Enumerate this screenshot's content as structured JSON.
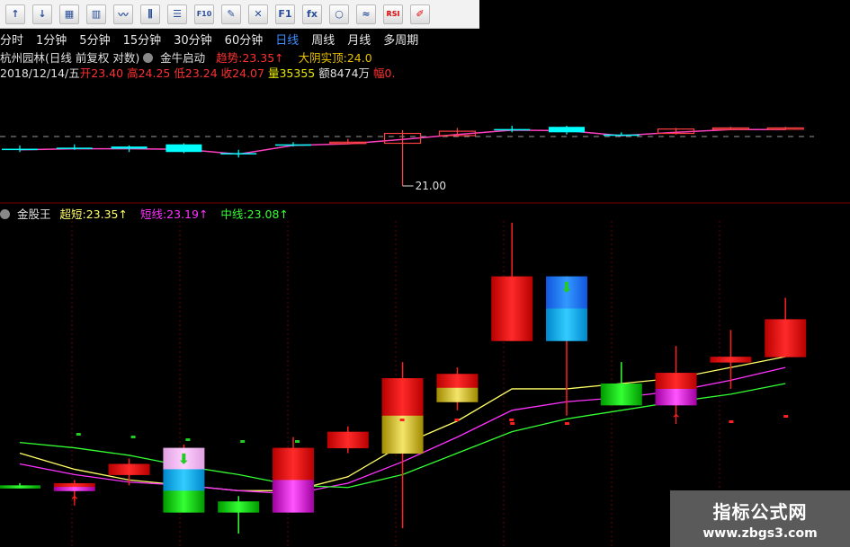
{
  "toolbar": {
    "buttons": [
      {
        "icon": "left-arrow-icon",
        "glyph": "↑"
      },
      {
        "icon": "down-arrow-icon",
        "glyph": "↓"
      },
      {
        "icon": "grid-icon",
        "glyph": "▦"
      },
      {
        "icon": "bars-icon",
        "glyph": "▥"
      },
      {
        "icon": "line-chart-icon",
        "glyph": "〰"
      },
      {
        "icon": "candlestick-icon",
        "glyph": "⫼"
      },
      {
        "icon": "list-icon",
        "glyph": "☰"
      },
      {
        "icon": "f10-icon",
        "glyph": "F10"
      },
      {
        "icon": "pencil-icon",
        "glyph": "✎"
      },
      {
        "icon": "compare-icon",
        "glyph": "✕"
      },
      {
        "icon": "f1-icon",
        "glyph": "F1"
      },
      {
        "icon": "formula-icon",
        "glyph": "fx"
      },
      {
        "icon": "circle-icon",
        "glyph": "○"
      },
      {
        "icon": "indicator-icon",
        "glyph": "≈"
      },
      {
        "icon": "rsi-icon",
        "glyph": "RSI"
      },
      {
        "icon": "brush-icon",
        "glyph": "✐"
      }
    ]
  },
  "periods": [
    "分时",
    "1分钟",
    "5分钟",
    "15分钟",
    "30分钟",
    "60分钟",
    "日线",
    "周线",
    "月线",
    "多周期"
  ],
  "active_period": "日线",
  "info": {
    "stock_title": "杭州园林(日线 前复权 对数)",
    "indicator_name": "金牛启动",
    "trend_label": "趋势:",
    "trend_value": "23.35↑",
    "big_yin_label": "大阴实顶:",
    "big_yin_value": "24.0",
    "date": "2018/12/14/五",
    "open_label": "开",
    "open_value": "23.40",
    "high_label": "高",
    "high_value": "24.25",
    "low_label": "低",
    "low_value": "23.24",
    "close_label": "收",
    "close_value": "24.07",
    "volume_label": "量",
    "volume_value": "35355",
    "amount_label": "额",
    "amount_value": "8474万",
    "amp_label": "幅",
    "amp_value": "0."
  },
  "sub_indicator": {
    "name": "金股王",
    "super_short_label": "超短:",
    "super_short_value": "23.35↑",
    "short_label": "短线:",
    "short_value": "23.19↑",
    "mid_label": "中线:",
    "mid_value": "23.08↑"
  },
  "colors": {
    "up": "#ff2020",
    "down": "#00ffff",
    "mid_line": "#ff3fbf",
    "yellow": "#ffff66",
    "green": "#33ff33",
    "magenta": "#ff33ff",
    "grid": "#6a0000"
  },
  "chart_data": [
    {
      "type": "candlestick",
      "panel": "main",
      "annotation": "21.00",
      "candles": [
        {
          "open": 22.7,
          "close": 22.7,
          "high": 22.85,
          "low": 22.55,
          "color": "down"
        },
        {
          "open": 22.75,
          "close": 22.75,
          "high": 22.9,
          "low": 22.65,
          "color": "down"
        },
        {
          "open": 22.8,
          "close": 22.7,
          "high": 22.85,
          "low": 22.55,
          "color": "down"
        },
        {
          "open": 22.9,
          "close": 22.55,
          "high": 22.95,
          "low": 22.5,
          "color": "down"
        },
        {
          "open": 22.5,
          "close": 22.5,
          "high": 22.65,
          "low": 22.3,
          "color": "down"
        },
        {
          "open": 22.9,
          "close": 22.9,
          "high": 23.0,
          "low": 22.8,
          "color": "down"
        },
        {
          "open": 22.95,
          "close": 23.0,
          "high": 23.15,
          "low": 22.95,
          "color": "up"
        },
        {
          "open": 22.95,
          "close": 23.4,
          "high": 23.55,
          "low": 21.0,
          "color": "up"
        },
        {
          "open": 23.3,
          "close": 23.5,
          "high": 23.65,
          "low": 23.25,
          "color": "up"
        },
        {
          "open": 23.6,
          "close": 23.6,
          "high": 23.75,
          "low": 23.45,
          "color": "down"
        },
        {
          "open": 23.7,
          "close": 23.45,
          "high": 23.75,
          "low": 23.35,
          "color": "down"
        },
        {
          "open": 23.35,
          "close": 23.35,
          "high": 23.45,
          "low": 23.3,
          "color": "down"
        },
        {
          "open": 23.4,
          "close": 23.6,
          "high": 23.65,
          "low": 23.35,
          "color": "up"
        },
        {
          "open": 23.6,
          "close": 23.65,
          "high": 23.7,
          "low": 23.55,
          "color": "up"
        },
        {
          "open": 23.6,
          "close": 23.65,
          "high": 23.7,
          "low": 23.55,
          "color": "up"
        }
      ]
    },
    {
      "type": "candlestick",
      "panel": "indicator",
      "title": "金股王",
      "candles": [
        {
          "open": 22.6,
          "close": 22.6,
          "high": 22.62,
          "low": 22.58,
          "fill": "green"
        },
        {
          "open": 22.62,
          "close": 22.55,
          "high": 22.65,
          "low": 22.45,
          "fill": "red-magenta"
        },
        {
          "open": 22.7,
          "close": 22.8,
          "high": 22.85,
          "low": 22.6,
          "fill": "red"
        },
        {
          "open": 22.35,
          "close": 22.95,
          "high": 22.98,
          "low": 22.35,
          "fill": "magenta-cyan-green",
          "signal": "down-arrow"
        },
        {
          "open": 22.35,
          "close": 22.45,
          "high": 22.5,
          "low": 22.15,
          "fill": "green"
        },
        {
          "open": 22.35,
          "close": 22.95,
          "high": 23.05,
          "low": 22.35,
          "fill": "magenta-red"
        },
        {
          "open": 22.95,
          "close": 23.1,
          "high": 23.15,
          "low": 22.9,
          "fill": "red"
        },
        {
          "open": 22.9,
          "close": 23.6,
          "high": 23.75,
          "low": 22.2,
          "fill": "yellow-red"
        },
        {
          "open": 23.38,
          "close": 23.64,
          "high": 23.7,
          "low": 23.3,
          "fill": "yellow-red"
        },
        {
          "open": 23.95,
          "close": 24.55,
          "high": 25.05,
          "low": 23.95,
          "fill": "red"
        },
        {
          "open": 24.55,
          "close": 23.95,
          "high": 24.55,
          "low": 23.25,
          "fill": "cyan-blue",
          "signal": "down-arrow"
        },
        {
          "open": 23.35,
          "close": 23.55,
          "high": 23.75,
          "low": 23.35,
          "fill": "green"
        },
        {
          "open": 23.35,
          "close": 23.65,
          "high": 23.9,
          "low": 23.25,
          "fill": "magenta-red"
        },
        {
          "open": 23.75,
          "close": 23.8,
          "high": 24.05,
          "low": 23.5,
          "fill": "red"
        },
        {
          "open": 23.8,
          "close": 24.15,
          "high": 24.35,
          "low": 23.8,
          "fill": "red"
        }
      ],
      "lines": [
        {
          "name": "超短",
          "color": "#ffff66",
          "values": [
            22.9,
            22.75,
            22.65,
            22.6,
            22.55,
            22.55,
            22.68,
            22.98,
            23.2,
            23.5,
            23.5,
            23.55,
            23.6,
            23.7,
            23.8
          ]
        },
        {
          "name": "短线",
          "color": "#ff33ff",
          "values": [
            22.8,
            22.7,
            22.63,
            22.6,
            22.55,
            22.52,
            22.62,
            22.82,
            23.05,
            23.3,
            23.38,
            23.42,
            23.48,
            23.58,
            23.7
          ]
        },
        {
          "name": "中线",
          "color": "#33ff33",
          "values": [
            23.0,
            22.95,
            22.88,
            22.78,
            22.7,
            22.6,
            22.58,
            22.7,
            22.9,
            23.1,
            23.22,
            23.3,
            23.38,
            23.45,
            23.55
          ]
        }
      ]
    }
  ],
  "watermark": {
    "title": "指标公式网",
    "url": "www.zbgs3.com"
  }
}
